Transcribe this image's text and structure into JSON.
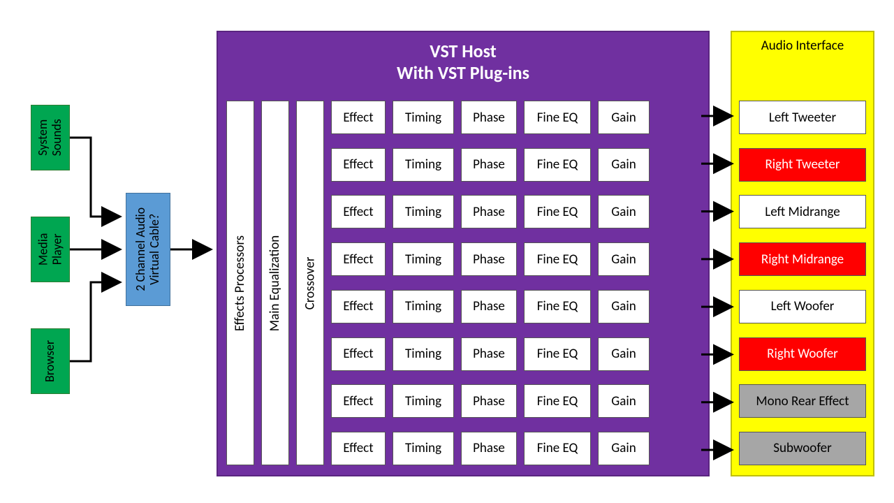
{
  "sources": [
    {
      "label": "System\nSounds"
    },
    {
      "label": "Media\nPlayer"
    },
    {
      "label": "Browser"
    }
  ],
  "cable": {
    "label": "2 Channel Audio\nVirtual Cable?"
  },
  "vst": {
    "title_line1": "VST Host",
    "title_line2": "With VST Plug-ins",
    "vertical_cols": {
      "effects": "Effects Processors",
      "eq": "Main Equalization",
      "xo": "Crossover"
    },
    "grid_labels": {
      "effect": "Effect",
      "timing": "Timing",
      "phase": "Phase",
      "fineeq": "Fine EQ",
      "gain": "Gain"
    },
    "row_count": 8
  },
  "interface": {
    "title": "Audio Interface",
    "outputs": [
      {
        "label": "Left Tweeter",
        "style": "white"
      },
      {
        "label": "Right Tweeter",
        "style": "red"
      },
      {
        "label": "Left Midrange",
        "style": "white"
      },
      {
        "label": "Right Midrange",
        "style": "red"
      },
      {
        "label": "Left Woofer",
        "style": "white"
      },
      {
        "label": "Right Woofer",
        "style": "red"
      },
      {
        "label": "Mono Rear Effect",
        "style": "gray"
      },
      {
        "label": "Subwoofer",
        "style": "gray"
      }
    ]
  },
  "colors": {
    "source": "#00A651",
    "cable": "#5B9BD5",
    "vst": "#7030A0",
    "iface": "#FFFF00",
    "red": "#FF0000",
    "gray": "#A6A6A6"
  }
}
